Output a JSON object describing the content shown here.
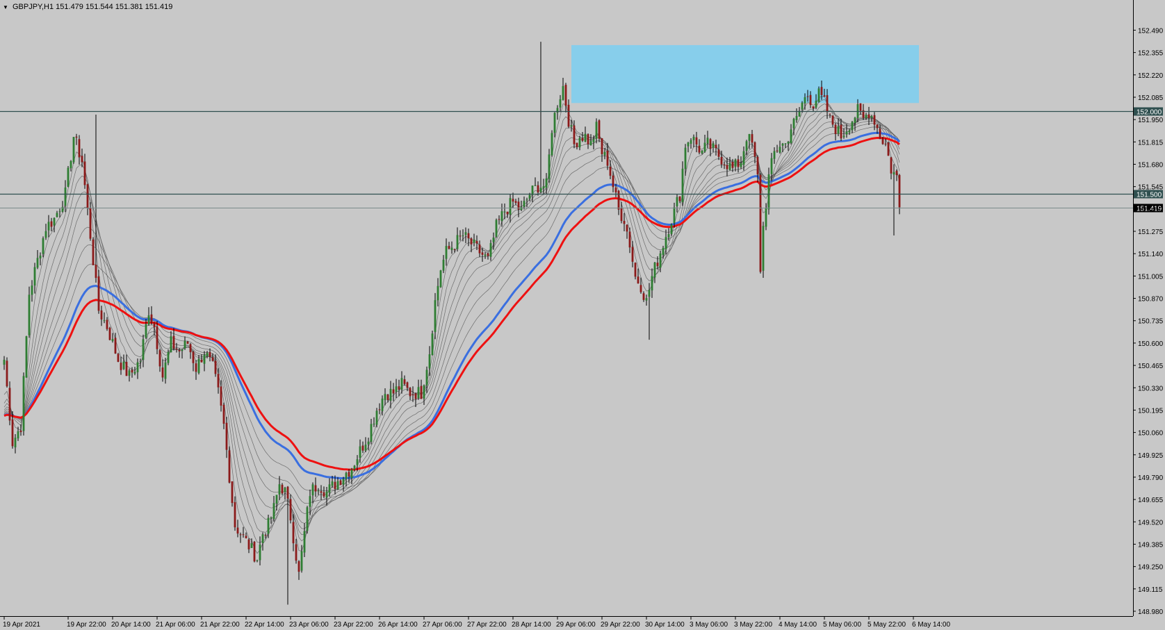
{
  "window": {
    "symbol": "GBPJPY,H1",
    "ohlc": "151.479 151.544 151.381 151.419",
    "dropdown_icon": "triangle-down-icon"
  },
  "colors": {
    "background": "#c8c8c8",
    "bull_candle": "#2e7d32",
    "bear_candle": "#8b1a1a",
    "wick": "#000000",
    "ema_red": "#ee1111",
    "ema_blue": "#3a6fe0",
    "ema_gray": "#555555",
    "zone": "#87ceeb",
    "hline": "#2f4f4f"
  },
  "chart_data": {
    "type": "candlestick",
    "symbol": "GBPJPY",
    "timeframe": "H1",
    "ylim": [
      148.98,
      152.58
    ],
    "y_ticks": [
      "152.490",
      "152.355",
      "152.220",
      "152.085",
      "151.950",
      "151.815",
      "151.680",
      "151.545",
      "151.410",
      "151.275",
      "151.140",
      "151.005",
      "150.870",
      "150.735",
      "150.600",
      "150.465",
      "150.330",
      "150.195",
      "150.060",
      "149.925",
      "149.790",
      "149.655",
      "149.520",
      "149.385",
      "149.250",
      "149.115",
      "148.980"
    ],
    "x_ticks": [
      {
        "label": "19 Apr 2021",
        "bar": 0
      },
      {
        "label": "19 Apr 22:00",
        "bar": 23
      },
      {
        "label": "20 Apr 14:00",
        "bar": 39
      },
      {
        "label": "21 Apr 06:00",
        "bar": 55
      },
      {
        "label": "21 Apr 22:00",
        "bar": 71
      },
      {
        "label": "22 Apr 14:00",
        "bar": 87
      },
      {
        "label": "23 Apr 06:00",
        "bar": 103
      },
      {
        "label": "23 Apr 22:00",
        "bar": 119
      },
      {
        "label": "26 Apr 14:00",
        "bar": 135
      },
      {
        "label": "27 Apr 06:00",
        "bar": 151
      },
      {
        "label": "27 Apr 22:00",
        "bar": 167
      },
      {
        "label": "28 Apr 14:00",
        "bar": 183
      },
      {
        "label": "29 Apr 06:00",
        "bar": 199
      },
      {
        "label": "29 Apr 22:00",
        "bar": 215
      },
      {
        "label": "30 Apr 14:00",
        "bar": 231
      },
      {
        "label": "3 May 06:00",
        "bar": 247
      },
      {
        "label": "3 May 22:00",
        "bar": 263
      },
      {
        "label": "4 May 14:00",
        "bar": 279
      },
      {
        "label": "5 May 06:00",
        "bar": 295
      },
      {
        "label": "5 May 22:00",
        "bar": 311
      },
      {
        "label": "6 May 14:00",
        "bar": 327
      }
    ],
    "horizontal_lines": [
      {
        "price": 152.0,
        "label": "152.000",
        "style": "solid"
      },
      {
        "price": 151.5,
        "label": "151.500",
        "style": "solid"
      },
      {
        "price": 151.419,
        "label": "151.419",
        "style": "current"
      }
    ],
    "supply_zone": {
      "bar_from": 204,
      "bar_to": 329,
      "price_low": 152.05,
      "price_high": 152.4
    },
    "anchors": [
      [
        0,
        150.5
      ],
      [
        3,
        150.0
      ],
      [
        6,
        150.1
      ],
      [
        9,
        150.9
      ],
      [
        12,
        151.1
      ],
      [
        15,
        151.3
      ],
      [
        18,
        151.35
      ],
      [
        22,
        151.5
      ],
      [
        25,
        151.85
      ],
      [
        28,
        151.7
      ],
      [
        30,
        151.4
      ],
      [
        32,
        151.1
      ],
      [
        34,
        150.8
      ],
      [
        37,
        150.7
      ],
      [
        41,
        150.5
      ],
      [
        45,
        150.4
      ],
      [
        49,
        150.5
      ],
      [
        52,
        150.8
      ],
      [
        54,
        150.7
      ],
      [
        57,
        150.4
      ],
      [
        60,
        150.6
      ],
      [
        63,
        150.55
      ],
      [
        66,
        150.6
      ],
      [
        69,
        150.45
      ],
      [
        72,
        150.55
      ],
      [
        75,
        150.45
      ],
      [
        77,
        150.3
      ],
      [
        79,
        150.1
      ],
      [
        81,
        149.8
      ],
      [
        83,
        149.5
      ],
      [
        85,
        149.45
      ],
      [
        87,
        149.4
      ],
      [
        89,
        149.35
      ],
      [
        91,
        149.3
      ],
      [
        93,
        149.45
      ],
      [
        95,
        149.5
      ],
      [
        97,
        149.6
      ],
      [
        99,
        149.75
      ],
      [
        101,
        149.7
      ],
      [
        103,
        149.55
      ],
      [
        106,
        149.2
      ],
      [
        108,
        149.45
      ],
      [
        110,
        149.7
      ],
      [
        113,
        149.75
      ],
      [
        116,
        149.7
      ],
      [
        119,
        149.75
      ],
      [
        122,
        149.8
      ],
      [
        125,
        149.85
      ],
      [
        128,
        149.95
      ],
      [
        131,
        150.05
      ],
      [
        134,
        150.2
      ],
      [
        137,
        150.3
      ],
      [
        140,
        150.3
      ],
      [
        143,
        150.35
      ],
      [
        146,
        150.3
      ],
      [
        150,
        150.3
      ],
      [
        153,
        150.55
      ],
      [
        155,
        150.85
      ],
      [
        157,
        151.05
      ],
      [
        159,
        151.15
      ],
      [
        162,
        151.2
      ],
      [
        165,
        151.25
      ],
      [
        168,
        151.2
      ],
      [
        171,
        151.15
      ],
      [
        174,
        151.1
      ],
      [
        177,
        151.3
      ],
      [
        180,
        151.4
      ],
      [
        183,
        151.45
      ],
      [
        186,
        151.4
      ],
      [
        189,
        151.5
      ],
      [
        192,
        151.55
      ],
      [
        195,
        151.55
      ],
      [
        197,
        151.9
      ],
      [
        199,
        152.05
      ],
      [
        201,
        152.15
      ],
      [
        203,
        151.95
      ],
      [
        205,
        151.8
      ],
      [
        207,
        151.85
      ],
      [
        209,
        151.85
      ],
      [
        211,
        151.8
      ],
      [
        213,
        151.9
      ],
      [
        215,
        151.75
      ],
      [
        217,
        151.7
      ],
      [
        219,
        151.55
      ],
      [
        221,
        151.4
      ],
      [
        223,
        151.35
      ],
      [
        225,
        151.2
      ],
      [
        227,
        151.0
      ],
      [
        229,
        150.95
      ],
      [
        231,
        150.85
      ],
      [
        233,
        151.0
      ],
      [
        235,
        151.1
      ],
      [
        237,
        151.2
      ],
      [
        239,
        151.3
      ],
      [
        241,
        151.4
      ],
      [
        243,
        151.5
      ],
      [
        245,
        151.8
      ],
      [
        247,
        151.85
      ],
      [
        249,
        151.8
      ],
      [
        251,
        151.75
      ],
      [
        253,
        151.8
      ],
      [
        256,
        151.75
      ],
      [
        259,
        151.7
      ],
      [
        262,
        151.65
      ],
      [
        265,
        151.7
      ],
      [
        267,
        151.85
      ],
      [
        269,
        151.8
      ],
      [
        271,
        151.6
      ],
      [
        272,
        151.05
      ],
      [
        273,
        151.3
      ],
      [
        275,
        151.6
      ],
      [
        277,
        151.75
      ],
      [
        279,
        151.8
      ],
      [
        281,
        151.8
      ],
      [
        283,
        151.9
      ],
      [
        285,
        151.95
      ],
      [
        287,
        152.05
      ],
      [
        289,
        152.1
      ],
      [
        291,
        152.05
      ],
      [
        293,
        152.1
      ],
      [
        295,
        152.05
      ],
      [
        297,
        151.95
      ],
      [
        299,
        151.9
      ],
      [
        301,
        151.85
      ],
      [
        303,
        151.9
      ],
      [
        305,
        151.95
      ],
      [
        307,
        152.0
      ],
      [
        309,
        151.95
      ],
      [
        311,
        152.0
      ],
      [
        313,
        151.95
      ],
      [
        315,
        151.85
      ],
      [
        317,
        151.8
      ],
      [
        319,
        151.65
      ],
      [
        321,
        151.6
      ],
      [
        322,
        151.42
      ]
    ],
    "ema_lines": [
      {
        "name": "EMA red",
        "color": "#ee1111",
        "period": 60
      },
      {
        "name": "EMA blue",
        "color": "#3a6fe0",
        "period": 50
      },
      {
        "name": "guide",
        "color": "#555555",
        "period": 4
      },
      {
        "name": "guide",
        "color": "#555555",
        "period": 7
      },
      {
        "name": "guide",
        "color": "#555555",
        "period": 10
      },
      {
        "name": "guide",
        "color": "#555555",
        "period": 14
      },
      {
        "name": "guide",
        "color": "#555555",
        "period": 18
      },
      {
        "name": "guide",
        "color": "#555555",
        "period": 24
      },
      {
        "name": "guide",
        "color": "#555555",
        "period": 30
      },
      {
        "name": "guide",
        "color": "#555555",
        "period": 38
      }
    ]
  }
}
